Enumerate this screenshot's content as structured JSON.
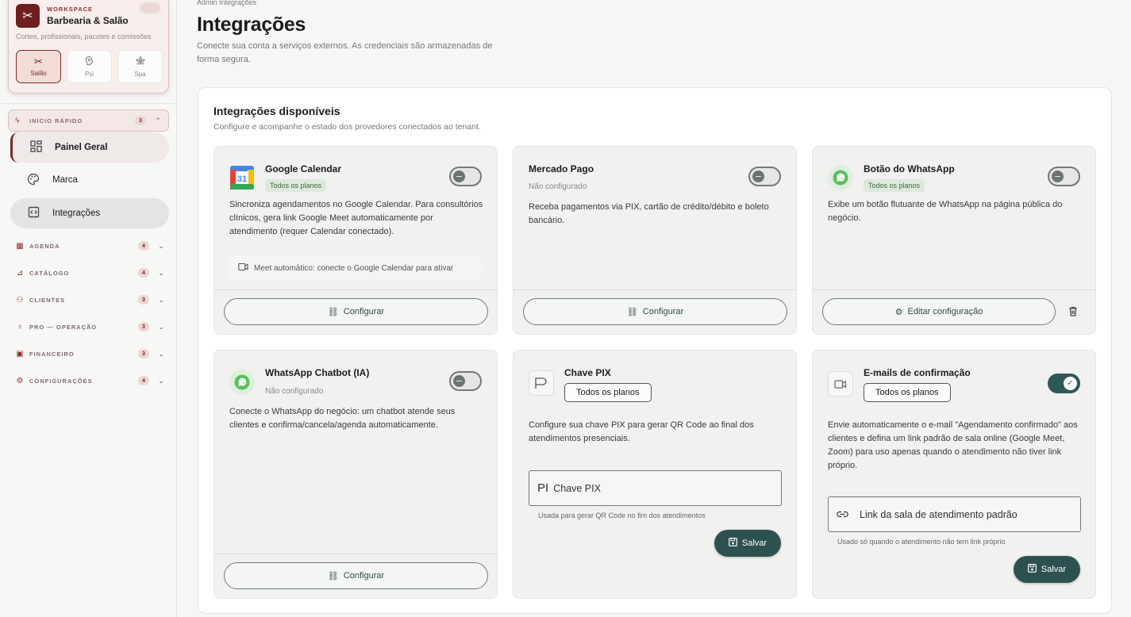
{
  "workspace": {
    "kicker": "WORKSPACE",
    "name": "Barbearia & Salão",
    "description": "Cortes, profissionais, pacotes e comissões",
    "modes": [
      {
        "label": "Salão",
        "icon": "scissors-icon"
      },
      {
        "label": "Psi",
        "icon": "head-icon"
      },
      {
        "label": "Spa",
        "icon": "lotus-icon"
      }
    ]
  },
  "quick_start": {
    "label": "INÍCIO RÁPIDO",
    "count": "3"
  },
  "nav": {
    "panel": "Painel Geral",
    "marca": "Marca",
    "integracoes": "Integrações"
  },
  "groups": [
    {
      "label": "AGENDA",
      "count": "4"
    },
    {
      "label": "CATÁLOGO",
      "count": "4"
    },
    {
      "label": "CLIENTES",
      "count": "3"
    },
    {
      "label": "PRO — OPERAÇÃO",
      "count": "3"
    },
    {
      "label": "FINANCEIRO",
      "count": "3"
    },
    {
      "label": "CONFIGURAÇÕES",
      "count": "4"
    }
  ],
  "page": {
    "breadcrumb": "Admin  Integrações",
    "title": "Integrações",
    "subtitle": "Conecte sua conta a serviços externos. As credenciais são armazenadas de forma segura."
  },
  "panel": {
    "title": "Integrações disponíveis",
    "subtitle": "Configure e acompanhe o estado dos provedores conectados ao tenant."
  },
  "cards": {
    "gcal": {
      "title": "Google Calendar",
      "plan": "Todos os planos",
      "desc": "Sincroniza agendamentos no Google Calendar. Para consultórios clínicos, gera link Google Meet automaticamente por atendimento (requer Calendar conectado).",
      "meet_note": "Meet automático: conecte o Google Calendar para ativar",
      "button": "Configurar",
      "enabled": false
    },
    "mpago": {
      "title": "Mercado Pago",
      "status": "Não configurado",
      "desc": "Receba pagamentos via PIX, cartão de crédito/débito e boleto bancário.",
      "button": "Configurar",
      "enabled": false
    },
    "wabtn": {
      "title": "Botão do WhatsApp",
      "plan": "Todos os planos",
      "desc": "Exibe um botão flutuante de WhatsApp na página pública do negócio.",
      "button": "Editar configuração",
      "enabled": false
    },
    "wabot": {
      "title": "WhatsApp Chatbot (IA)",
      "status": "Não configurado",
      "desc": "Conecte o WhatsApp do negócio: um chatbot atende seus clientes e confirma/cancela/agenda automaticamente.",
      "button": "Configurar",
      "enabled": false
    },
    "pix": {
      "title": "Chave PIX",
      "plan": "Todos os planos",
      "desc": "Configure sua chave PIX para gerar QR Code ao final dos atendimentos presenciais.",
      "field_prefix": "PI",
      "field_placeholder": "Chave PIX",
      "helper": "Usada para gerar QR Code no fim dos atendimentos",
      "button": "Salvar"
    },
    "email": {
      "title": "E-mails de confirmação",
      "plan": "Todos os planos",
      "desc": "Envie automaticamente o e-mail \"Agendamento confirmado\" aos clientes e defina um link padrão de sala online (Google Meet, Zoom) para uso apenas quando o atendimento não tiver link próprio.",
      "field_placeholder": "Link da sala de atendimento padrão",
      "helper": "Usado só quando o atendimento não tem link próprio",
      "button": "Salvar",
      "enabled": true
    }
  },
  "colors": {
    "brand": "#6e1e1e",
    "accent": "#2d5151",
    "plan_pill_bg": "#dde9dc",
    "whatsapp": "#56c15b"
  }
}
